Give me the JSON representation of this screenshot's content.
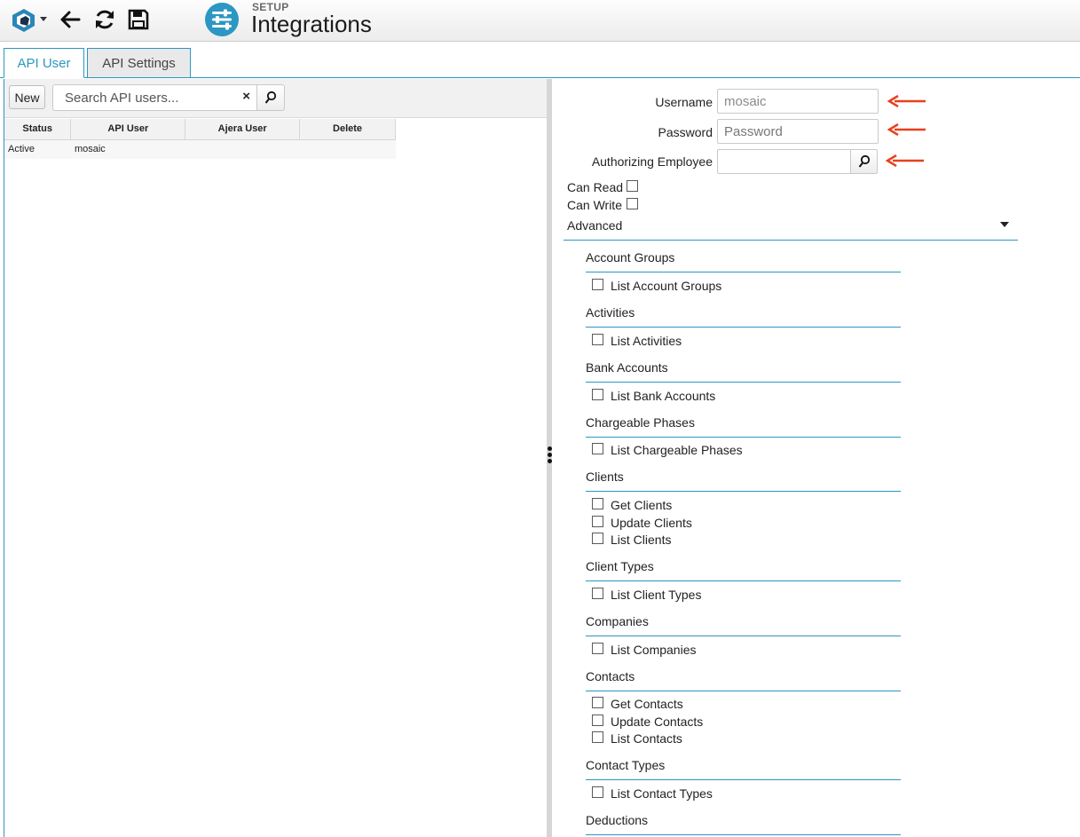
{
  "header": {
    "section": "SETUP",
    "title": "Integrations",
    "icons": [
      "app-logo-icon",
      "back-arrow-icon",
      "refresh-icon",
      "save-icon",
      "settings-sliders-icon"
    ],
    "accent_color": "#2b97c2"
  },
  "tabs": [
    {
      "label": "API User",
      "active": true
    },
    {
      "label": "API Settings",
      "active": false
    }
  ],
  "list": {
    "new_label": "New",
    "search_placeholder": "Search API users...",
    "clear_glyph": "×",
    "columns": [
      "Status",
      "API User",
      "Ajera User",
      "Delete"
    ],
    "rows": [
      {
        "status": "Active",
        "api_user": "mosaic",
        "ajera_user": "",
        "delete": ""
      }
    ]
  },
  "form": {
    "username_label": "Username",
    "username_value": "mosaic",
    "password_label": "Password",
    "password_placeholder": "Password",
    "employee_label": "Authorizing Employee",
    "employee_value": "",
    "can_read_label": "Can Read",
    "can_write_label": "Can Write",
    "advanced_label": "Advanced",
    "annotation_color": "#e8401c"
  },
  "permission_groups": [
    {
      "title": "Account Groups",
      "items": [
        "List Account Groups"
      ]
    },
    {
      "title": "Activities",
      "items": [
        "List Activities"
      ]
    },
    {
      "title": "Bank Accounts",
      "items": [
        "List Bank Accounts"
      ]
    },
    {
      "title": "Chargeable Phases",
      "items": [
        "List Chargeable Phases"
      ]
    },
    {
      "title": "Clients",
      "items": [
        "Get Clients",
        "Update Clients",
        "List Clients"
      ]
    },
    {
      "title": "Client Types",
      "items": [
        "List Client Types"
      ]
    },
    {
      "title": "Companies",
      "items": [
        "List Companies"
      ]
    },
    {
      "title": "Contacts",
      "items": [
        "Get Contacts",
        "Update Contacts",
        "List Contacts"
      ]
    },
    {
      "title": "Contact Types",
      "items": [
        "List Contact Types"
      ]
    },
    {
      "title": "Deductions",
      "items": []
    }
  ]
}
